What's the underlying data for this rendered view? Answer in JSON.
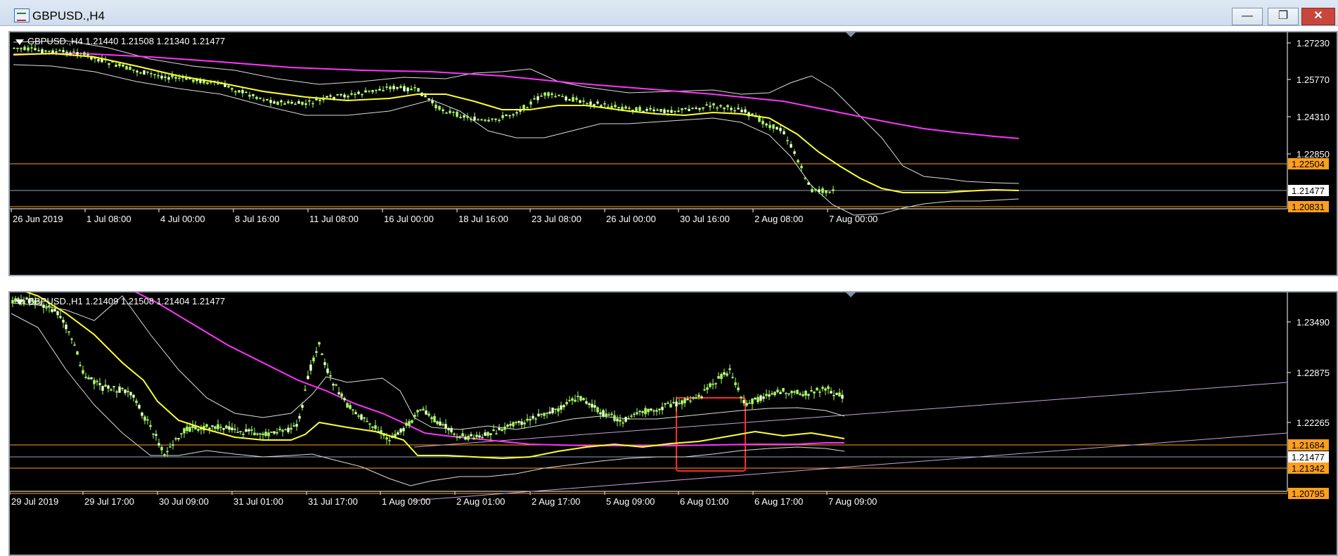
{
  "window": {
    "title": "GBPUSD.,H4",
    "buttons": {
      "minimize": "—",
      "maximize": "❐",
      "close": "✕"
    }
  },
  "top_chart": {
    "header": "GBPUSD.,H4  1.21440 1.21508 1.21340 1.21477",
    "price_labels": [
      "1.27230",
      "1.25770",
      "1.24310",
      "1.22850"
    ],
    "hlines": [
      {
        "label": "1.22504",
        "color": "#ff9f1c"
      },
      {
        "label": "1.20831",
        "color": "#ff9f1c"
      }
    ],
    "current_price": "1.21477",
    "time_labels": [
      "26 Jun 2019",
      "1 Jul 08:00",
      "4 Jul 00:00",
      "8 Jul 16:00",
      "11 Jul 08:00",
      "16 Jul 00:00",
      "18 Jul 16:00",
      "23 Jul 08:00",
      "26 Jul 00:00",
      "30 Jul 16:00",
      "2 Aug 08:00",
      "7 Aug 00:00"
    ]
  },
  "bottom_chart": {
    "header": "GBPUSD.,H1  1.21409 1.21508 1.21404 1.21477",
    "price_labels": [
      "1.23490",
      "1.22875",
      "1.22265"
    ],
    "hlines": [
      {
        "label": "1.21684",
        "color": "#ff9f1c"
      },
      {
        "label": "1.21342",
        "color": "#ff9f1c"
      },
      {
        "label": "1.20795",
        "color": "#ff9f1c"
      }
    ],
    "current_price": "1.21477",
    "time_labels": [
      "29 Jul 2019",
      "29 Jul 17:00",
      "30 Jul 09:00",
      "31 Jul 01:00",
      "31 Jul 17:00",
      "1 Aug 09:00",
      "2 Aug 01:00",
      "2 Aug 17:00",
      "5 Aug 09:00",
      "6 Aug 01:00",
      "6 Aug 17:00",
      "7 Aug 09:00"
    ]
  },
  "colors": {
    "background": "#000000",
    "bull_candle": "#aaff66",
    "bear_candle": "#ffffff",
    "ma_fast": "#ffff33",
    "ma_slow": "#ff33ff",
    "bands": "#dddddd",
    "level": "#ff9f1c",
    "trendline": "#c9a0dc",
    "highlight_box": "#ff2a2a"
  }
}
